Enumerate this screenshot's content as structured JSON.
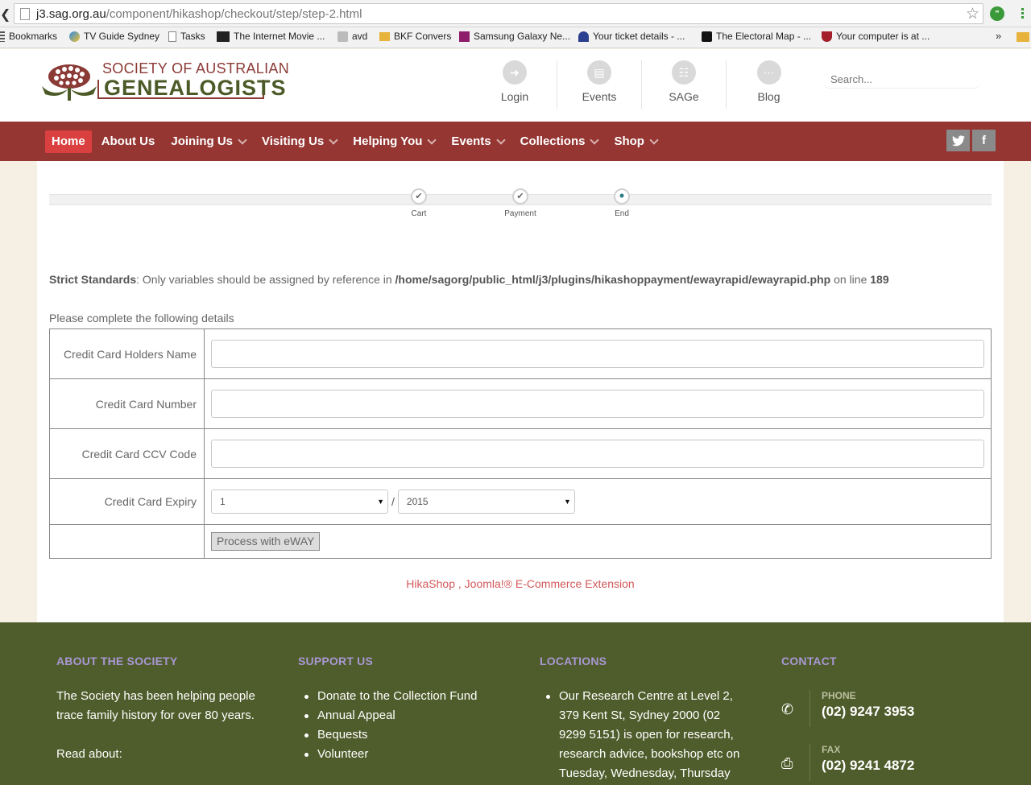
{
  "browser": {
    "url_host": "j3.sag.org.au",
    "url_path": "/component/hikashop/checkout/step/step-2.html",
    "bookmarks": [
      {
        "label": "Bookmarks",
        "icon": "bookmarks-apps-icon"
      },
      {
        "label": "TV Guide Sydney",
        "icon": "tv-guide-icon"
      },
      {
        "label": "Tasks",
        "icon": "page-icon"
      },
      {
        "label": "The Internet Movie ...",
        "icon": "imdb-icon"
      },
      {
        "label": "avd",
        "icon": "avd-icon"
      },
      {
        "label": "BKF Convers",
        "icon": "folder-icon"
      },
      {
        "label": "Samsung Galaxy Ne...",
        "icon": "m-icon"
      },
      {
        "label": "Your ticket details - ...",
        "icon": "ticket-icon"
      },
      {
        "label": "The Electoral Map - ...",
        "icon": "nyt-icon"
      },
      {
        "label": "Your computer is at ...",
        "icon": "shield-icon"
      }
    ],
    "bookmarks_overflow": "»"
  },
  "header": {
    "logo_line1": "SOCIETY OF AUSTRALIAN",
    "logo_line2": "GENEALOGISTS",
    "links": [
      {
        "label": "Login",
        "icon": "login-icon"
      },
      {
        "label": "Events",
        "icon": "calendar-icon"
      },
      {
        "label": "SAGe",
        "icon": "document-icon"
      },
      {
        "label": "Blog",
        "icon": "chat-icon"
      }
    ],
    "search_placeholder": "Search..."
  },
  "nav": {
    "items": [
      {
        "label": "Home",
        "active": true,
        "dropdown": false
      },
      {
        "label": "About Us",
        "active": false,
        "dropdown": false
      },
      {
        "label": "Joining Us",
        "active": false,
        "dropdown": true
      },
      {
        "label": "Visiting Us",
        "active": false,
        "dropdown": true
      },
      {
        "label": "Helping You",
        "active": false,
        "dropdown": true
      },
      {
        "label": "Events",
        "active": false,
        "dropdown": true
      },
      {
        "label": "Collections",
        "active": false,
        "dropdown": true
      },
      {
        "label": "Shop",
        "active": false,
        "dropdown": true
      }
    ],
    "social": [
      {
        "name": "twitter",
        "glyph": "t"
      },
      {
        "name": "facebook",
        "glyph": "f"
      }
    ]
  },
  "checkout": {
    "steps": [
      {
        "label": "Cart",
        "state": "done"
      },
      {
        "label": "Payment",
        "state": "done"
      },
      {
        "label": "End",
        "state": "current"
      }
    ],
    "notice_prefix": "Strict Standards",
    "notice_text": ": Only variables should be assigned by reference in ",
    "notice_path": "/home/sagorg/public_html/j3/plugins/hikashoppayment/ewayrapid/ewayrapid.php",
    "notice_line_text": " on line ",
    "notice_line": "189",
    "intro": "Please complete the following details",
    "fields": {
      "holder_label": "Credit Card Holders Name",
      "number_label": "Credit Card Number",
      "ccv_label": "Credit Card CCV Code",
      "expiry_label": "Credit Card Expiry",
      "expiry_month": "1",
      "expiry_separator": "/",
      "expiry_year": "2015",
      "submit_label": "Process with eWAY"
    },
    "powered_by": "HikaShop , Joomla!® E-Commerce Extension"
  },
  "footer": {
    "about": {
      "heading": "ABOUT THE SOCIETY",
      "text": "The Society has been helping people trace family history for over 80 years.",
      "read_about": "Read about:"
    },
    "support": {
      "heading": "SUPPORT US",
      "items": [
        "Donate to the Collection Fund",
        "Annual Appeal",
        "Bequests",
        "Volunteer"
      ]
    },
    "locations": {
      "heading": "LOCATIONS",
      "items": [
        "Our Research Centre at Level 2, 379 Kent St, Sydney 2000 (02 9299 5151) is open for research, research advice, bookshop etc on Tuesday, Wednesday, Thursday"
      ]
    },
    "contact": {
      "heading": "CONTACT",
      "phone_label": "PHONE",
      "phone": "(02) 9247 3953",
      "fax_label": "FAX",
      "fax": "(02) 9241 4872"
    }
  },
  "colors": {
    "nav_bg": "#953633",
    "nav_active": "#d9403f",
    "footer_bg": "#4f5c2b",
    "footer_heading": "#a898d4",
    "logo_red": "#8b3a36",
    "logo_green": "#4c5a28",
    "link_red": "#d2585a"
  }
}
